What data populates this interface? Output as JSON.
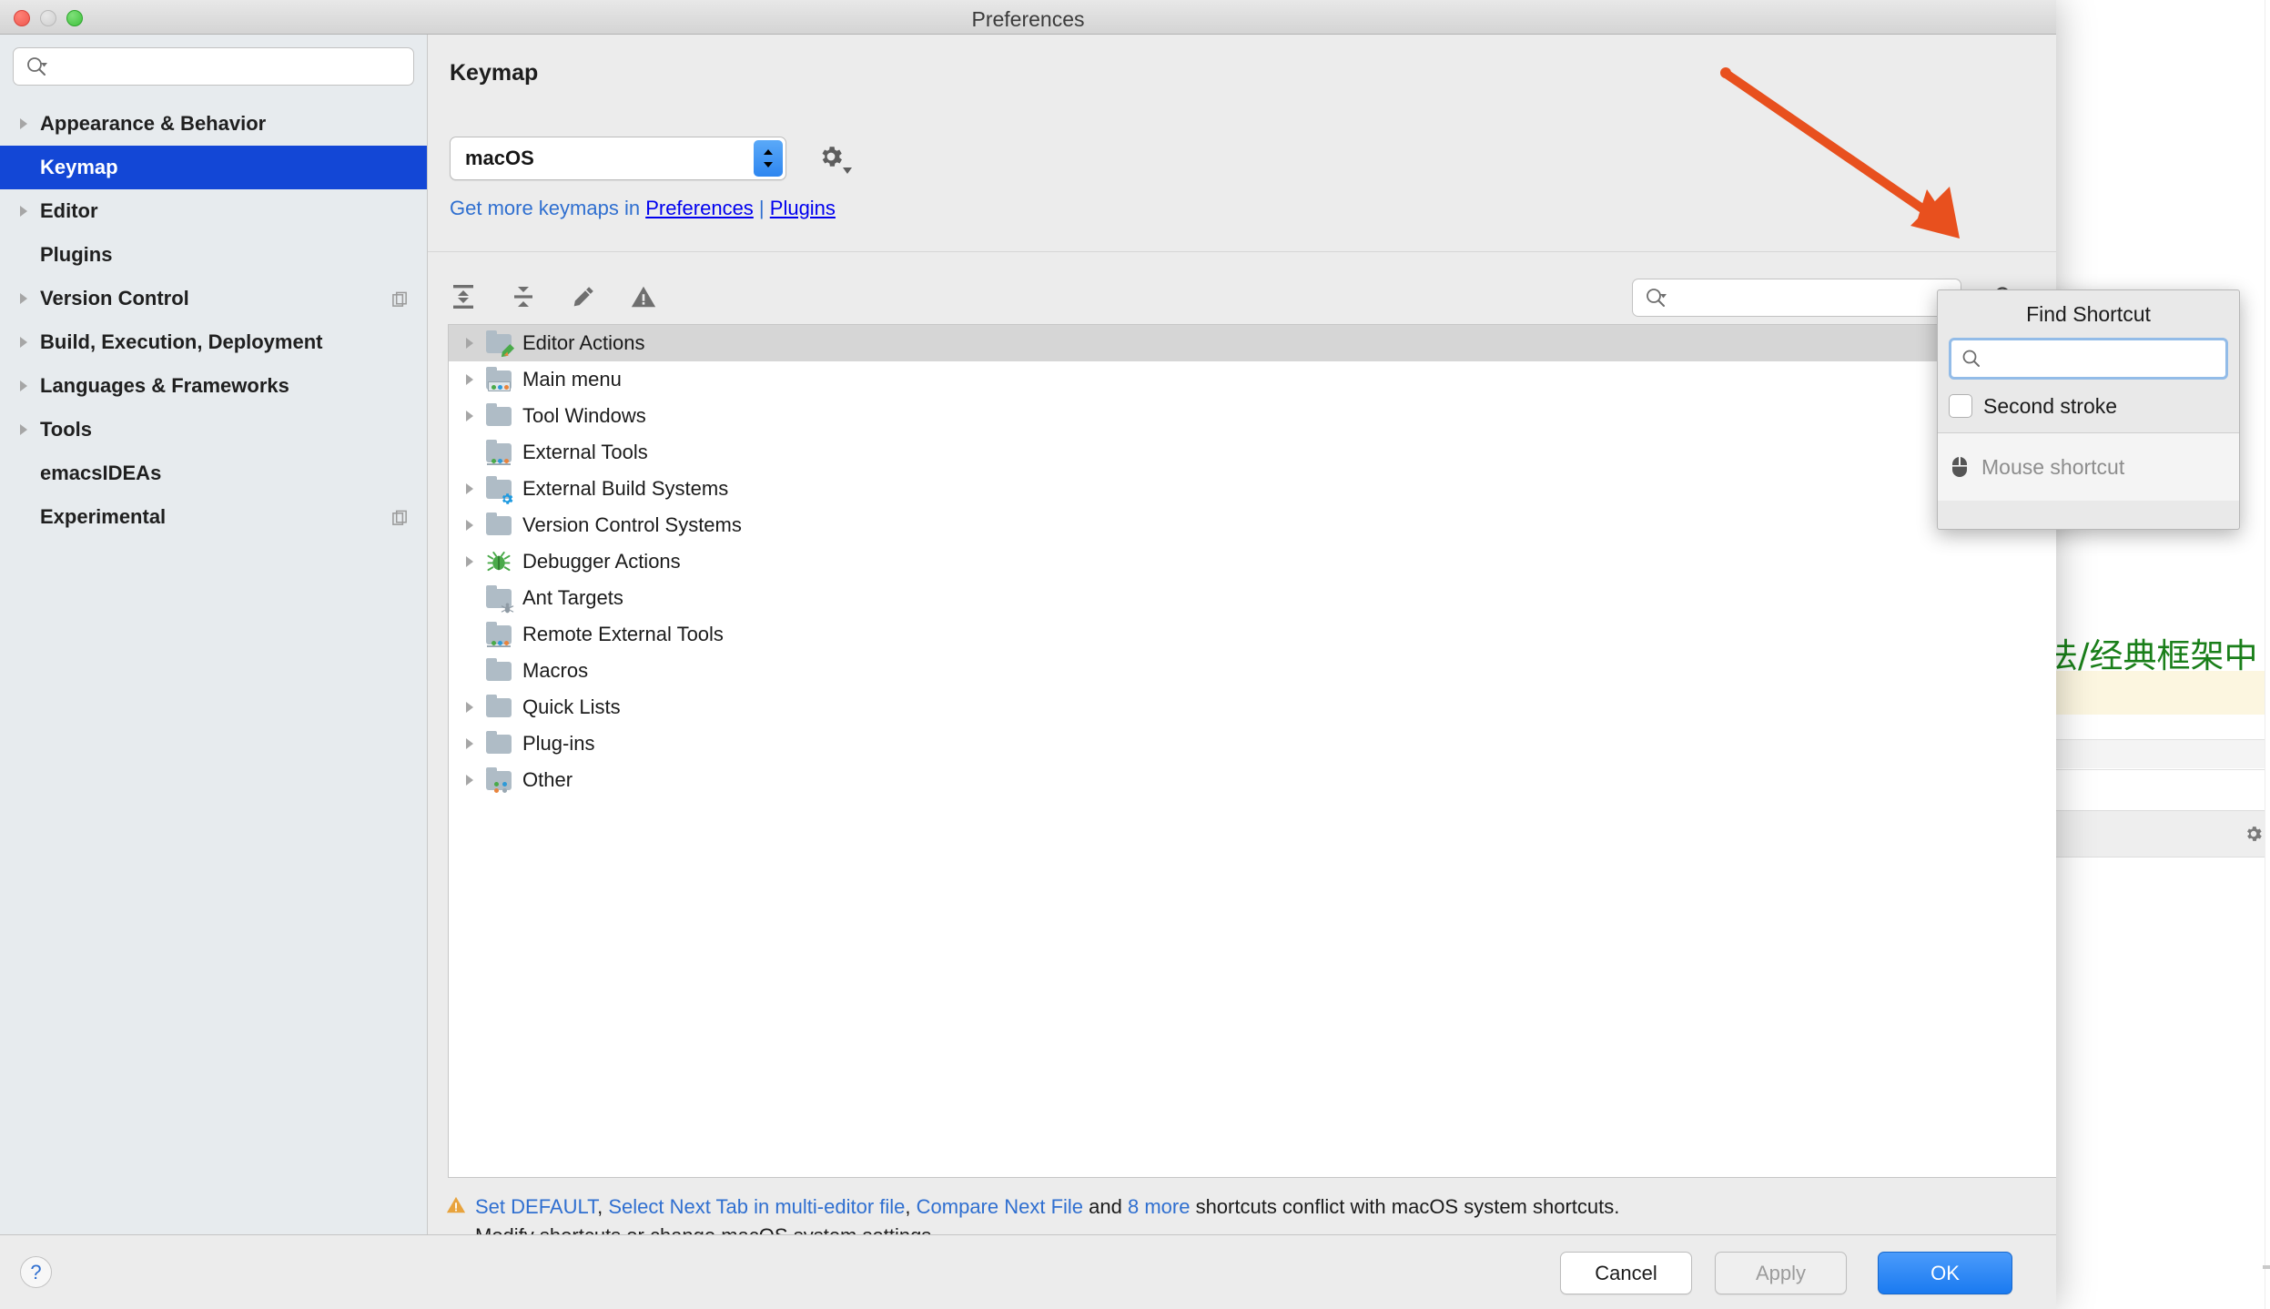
{
  "window": {
    "title": "Preferences",
    "traffic_lights": [
      "close",
      "minimize",
      "maximize"
    ]
  },
  "sidebar": {
    "search": {
      "value": "",
      "placeholder": ""
    },
    "items": [
      {
        "label": "Appearance & Behavior",
        "expandable": true,
        "selected": false,
        "badge": false
      },
      {
        "label": "Keymap",
        "expandable": false,
        "selected": true,
        "badge": false
      },
      {
        "label": "Editor",
        "expandable": true,
        "selected": false,
        "badge": false
      },
      {
        "label": "Plugins",
        "expandable": false,
        "selected": false,
        "badge": false
      },
      {
        "label": "Version Control",
        "expandable": true,
        "selected": false,
        "badge": true
      },
      {
        "label": "Build, Execution, Deployment",
        "expandable": true,
        "selected": false,
        "badge": false
      },
      {
        "label": "Languages & Frameworks",
        "expandable": true,
        "selected": false,
        "badge": false
      },
      {
        "label": "Tools",
        "expandable": true,
        "selected": false,
        "badge": false
      },
      {
        "label": "emacsIDEAs",
        "expandable": false,
        "selected": false,
        "badge": false
      },
      {
        "label": "Experimental",
        "expandable": false,
        "selected": false,
        "badge": true
      }
    ]
  },
  "main": {
    "heading": "Keymap",
    "keymap_select": {
      "value": "macOS"
    },
    "gear_icon": "gear-icon",
    "more_keymaps": {
      "prefix": "Get more keymaps in ",
      "link_a": "Preferences",
      "separator": " | ",
      "link_b": "Plugins"
    },
    "toolbar": [
      {
        "name": "expand-all-icon",
        "tooltip": "Expand All"
      },
      {
        "name": "collapse-all-icon",
        "tooltip": "Collapse All"
      },
      {
        "name": "edit-shortcut-icon",
        "tooltip": "Edit Shortcut"
      },
      {
        "name": "conflicts-icon",
        "tooltip": "Show Conflicts"
      }
    ],
    "shortcut_search": {
      "value": "",
      "placeholder": ""
    },
    "find_shortcut_button": "find-shortcut-icon",
    "tree": [
      {
        "label": "Editor Actions",
        "expandable": true,
        "selected": true,
        "icon": "folder-editor-actions"
      },
      {
        "label": "Main menu",
        "expandable": true,
        "selected": false,
        "icon": "folder-main-menu"
      },
      {
        "label": "Tool Windows",
        "expandable": true,
        "selected": false,
        "icon": "folder-plain"
      },
      {
        "label": "External Tools",
        "expandable": false,
        "selected": false,
        "icon": "folder-external-tools"
      },
      {
        "label": "External Build Systems",
        "expandable": true,
        "selected": false,
        "icon": "folder-build-systems"
      },
      {
        "label": "Version Control Systems",
        "expandable": true,
        "selected": false,
        "icon": "folder-plain"
      },
      {
        "label": "Debugger Actions",
        "expandable": true,
        "selected": false,
        "icon": "bug-icon"
      },
      {
        "label": "Ant Targets",
        "expandable": false,
        "selected": false,
        "icon": "folder-ant"
      },
      {
        "label": "Remote External Tools",
        "expandable": false,
        "selected": false,
        "icon": "folder-external-tools"
      },
      {
        "label": "Macros",
        "expandable": false,
        "selected": false,
        "icon": "folder-plain"
      },
      {
        "label": "Quick Lists",
        "expandable": true,
        "selected": false,
        "icon": "folder-plain"
      },
      {
        "label": "Plug-ins",
        "expandable": true,
        "selected": false,
        "icon": "folder-plain"
      },
      {
        "label": "Other",
        "expandable": true,
        "selected": false,
        "icon": "folder-other"
      }
    ],
    "conflict": {
      "icon": "warning-triangle-icon",
      "link1": "Set DEFAULT",
      "sep1": ", ",
      "link2": "Select Next Tab in multi-editor file",
      "sep2": ", ",
      "link3": "Compare Next File",
      "and": " and ",
      "link4": "8 more",
      "tail": " shortcuts conflict with macOS system shortcuts.",
      "line2": "Modify shortcuts or change macOS system settings."
    }
  },
  "find_shortcut_popup": {
    "title": "Find Shortcut",
    "search": {
      "value": "",
      "placeholder": ""
    },
    "search_icon": "search-icon",
    "second_stroke": {
      "label": "Second stroke",
      "checked": false
    },
    "mouse_shortcut": {
      "label": "Mouse shortcut",
      "icon": "mouse-icon",
      "disabled": true
    }
  },
  "footer": {
    "help": "?",
    "cancel": "Cancel",
    "apply": "Apply",
    "ok": "OK"
  },
  "annotation": {
    "arrow_color": "#E8501E",
    "points_to": "find-shortcut-icon"
  },
  "background": {
    "chinese_text": "法/经典框架中"
  },
  "colors": {
    "selection_blue": "#1347D6",
    "link_blue": "#2F6FD0",
    "ok_blue": "#1A7AF0",
    "warning_amber": "#E8A33D",
    "arrow_orange": "#E8501E"
  }
}
